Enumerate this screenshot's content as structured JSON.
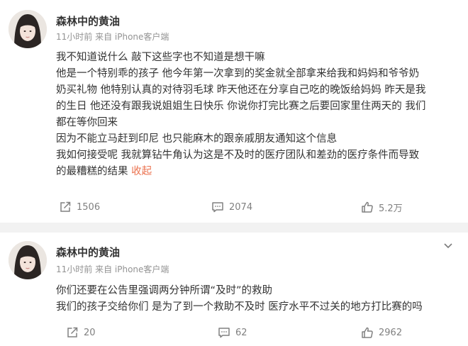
{
  "posts": [
    {
      "username": "森林中的黄油",
      "meta": "11小时前 来自 iPhone客户端",
      "lines": [
        "我不知道说什么 敲下这些字也不知道是想干嘛",
        "他是一个特别乖的孩子 他今年第一次拿到的奖金就全部拿来给我和妈妈和爷爷奶",
        "奶买礼物 他特别认真的对待羽毛球 昨天他还在分享自己吃的晚饭给妈妈 昨天是我",
        "的生日 他还没有跟我说姐姐生日快乐 你说你打完比赛之后要回家里住两天的 我们",
        "都在等你回来",
        "因为不能立马赶到印尼 也只能麻木的跟亲戚朋友通知这个信息",
        "我如何接受呢 我就算钻牛角认为这是不及时的医疗团队和差劲的医疗条件而导致",
        "的最糟糕的结果 "
      ],
      "collapse_label": "收起",
      "reposts": "1506",
      "comments": "2074",
      "likes": "5.2万"
    },
    {
      "username": "森林中的黄油",
      "meta": "11小时前 来自 iPhone客户端",
      "lines": [
        "你们还要在公告里强调两分钟所谓“及时”的救助",
        "我们的孩子交给你们 是为了到一个救助不及时 医疗水平不过关的地方打比赛的吗"
      ],
      "reposts": "20",
      "comments": "62",
      "likes": "2962"
    }
  ],
  "icons": {
    "repost": "repost-icon",
    "comment": "comment-icon",
    "like": "thumbs-up-icon",
    "menu": "chevron-down-icon"
  },
  "colors": {
    "text": "#333333",
    "meta": "#939393",
    "action": "#808080",
    "collapse_link": "#eb7350",
    "separator": "#f2f2f2"
  }
}
